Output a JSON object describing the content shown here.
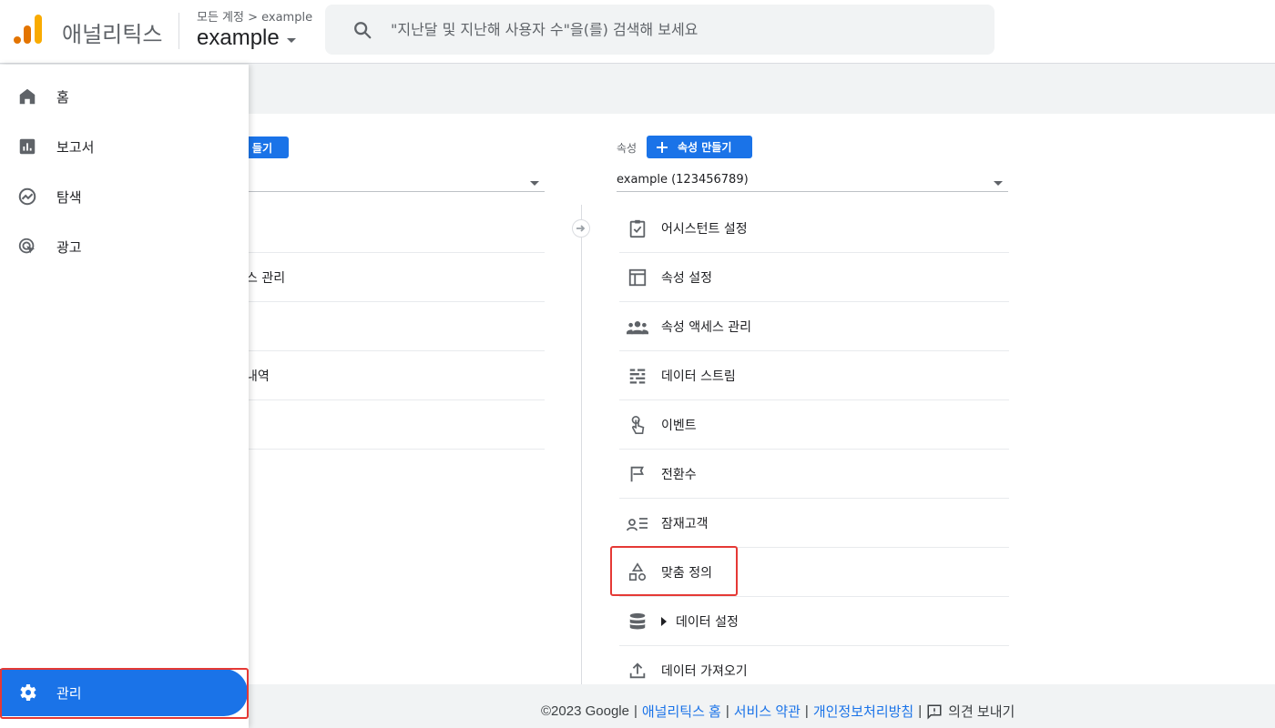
{
  "header": {
    "app_title": "애널리틱스",
    "breadcrumb": "모든 계정 > example",
    "account_name": "example",
    "search_placeholder": "\"지난달 및 지난해 사용자 수\"을(를) 검색해 보세요"
  },
  "sidebar": {
    "items": [
      {
        "label": "홈",
        "icon": "home-icon"
      },
      {
        "label": "보고서",
        "icon": "bar-chart-icon"
      },
      {
        "label": "탐색",
        "icon": "explore-icon"
      },
      {
        "label": "광고",
        "icon": "ads-icon"
      }
    ],
    "admin_label": "관리",
    "admin_icon": "gear-icon"
  },
  "account_column": {
    "create_label": "들기",
    "rows": [
      "",
      "스 관리",
      "",
      "내역",
      ""
    ]
  },
  "property_column": {
    "label": "속성",
    "create_label": "속성 만들기",
    "selected": "example (123456789)",
    "items": [
      {
        "label": "어시스턴트 설정",
        "icon": "assistant-icon"
      },
      {
        "label": "속성 설정",
        "icon": "property-settings-icon"
      },
      {
        "label": "속성 액세스 관리",
        "icon": "people-icon"
      },
      {
        "label": "데이터 스트림",
        "icon": "data-stream-icon"
      },
      {
        "label": "이벤트",
        "icon": "touch-icon"
      },
      {
        "label": "전환수",
        "icon": "flag-icon"
      },
      {
        "label": "잠재고객",
        "icon": "audience-icon"
      },
      {
        "label": "맞춤 정의",
        "icon": "shapes-icon"
      },
      {
        "label": "데이터 설정",
        "icon": "database-icon"
      },
      {
        "label": "데이터 가져오기",
        "icon": "upload-icon"
      }
    ]
  },
  "footer": {
    "copyright": "©2023 Google",
    "links": [
      "애널리틱스 홈",
      "서비스 약관",
      "개인정보처리방침"
    ],
    "feedback": "의견 보내기"
  },
  "colors": {
    "accent": "#1a73e8",
    "highlight": "#e53935",
    "logo_orange": "#f9ab00",
    "logo_dark_orange": "#e37400"
  }
}
